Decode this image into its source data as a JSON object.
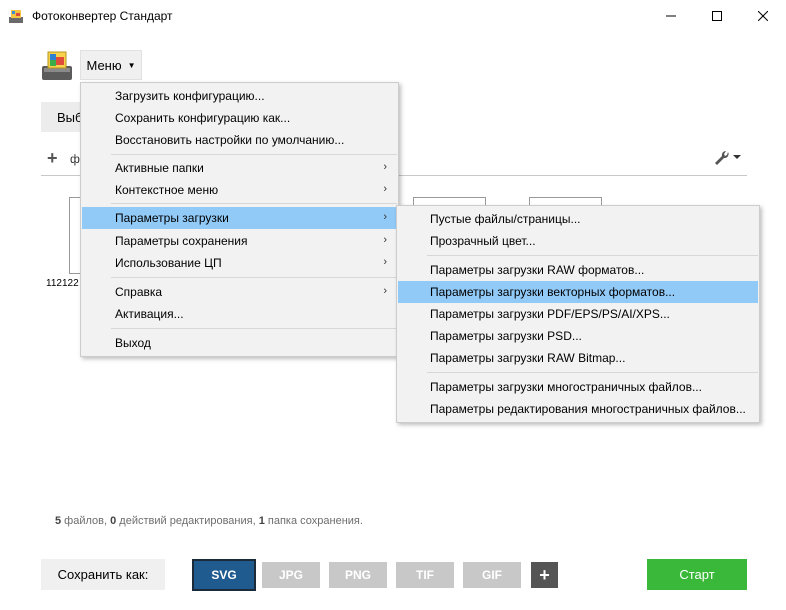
{
  "window": {
    "title": "Фотоконвертер Стандарт",
    "controls": {
      "minimize": "—",
      "maximize": "☐",
      "close": "✕"
    }
  },
  "header": {
    "menu_label": "Меню",
    "menu_caret": "▼"
  },
  "background": {
    "select_label": "Выбр",
    "add_label": "ф",
    "thumb_caption": "112122"
  },
  "main_menu": {
    "items": [
      {
        "label": "Загрузить конфигурацию..."
      },
      {
        "label": "Сохранить конфигурацию как..."
      },
      {
        "label": "Восстановить настройки по умолчанию..."
      },
      {
        "label": "Активные папки",
        "arrow": "›"
      },
      {
        "label": "Контекстное меню",
        "arrow": "›"
      },
      {
        "label": "Параметры загрузки",
        "arrow": "›"
      },
      {
        "label": "Параметры сохранения",
        "arrow": "›"
      },
      {
        "label": "Использование ЦП",
        "arrow": "›"
      },
      {
        "label": "Справка",
        "arrow": "›"
      },
      {
        "label": "Активация..."
      },
      {
        "label": "Выход"
      }
    ]
  },
  "sub_menu": {
    "items": [
      {
        "label": "Пустые файлы/страницы..."
      },
      {
        "label": "Прозрачный цвет..."
      },
      {
        "label": "Параметры загрузки RAW форматов..."
      },
      {
        "label": "Параметры загрузки векторных форматов..."
      },
      {
        "label": "Параметры загрузки PDF/EPS/PS/AI/XPS..."
      },
      {
        "label": "Параметры загрузки PSD..."
      },
      {
        "label": "Параметры загрузки RAW Bitmap..."
      },
      {
        "label": "Параметры загрузки многостраничных файлов..."
      },
      {
        "label": "Параметры редактирования многостраничных файлов..."
      }
    ]
  },
  "status": {
    "files_count": "5",
    "files_text": " файлов, ",
    "edits_count": "0",
    "edits_text": " действий редактирования, ",
    "folders_count": "1",
    "folders_text": " папка сохранения."
  },
  "bottom": {
    "save_as_label": "Сохранить как:",
    "formats": [
      "SVG",
      "JPG",
      "PNG",
      "TIF",
      "GIF"
    ],
    "add_format": "+",
    "start_label": "Старт"
  },
  "colors": {
    "highlight": "#91c9f7",
    "svg_selected": "#1f5b8e",
    "format_inactive": "#c8c8c8",
    "start": "#3ab83a"
  }
}
